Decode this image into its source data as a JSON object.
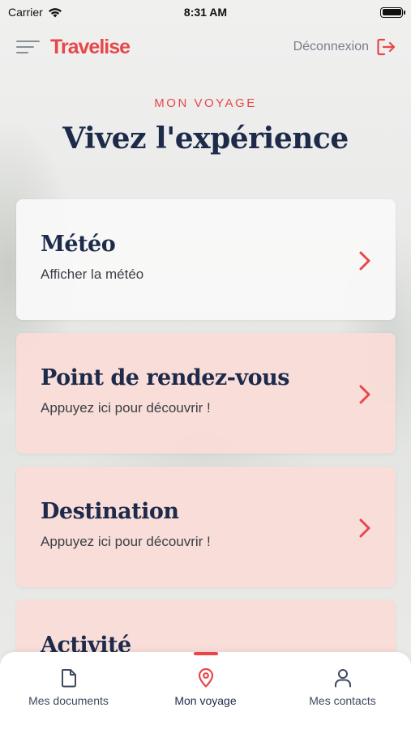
{
  "status_bar": {
    "carrier": "Carrier",
    "time": "8:31 AM"
  },
  "header": {
    "logo": "Travelise",
    "logout_label": "Déconnexion"
  },
  "page": {
    "kicker": "MON VOYAGE",
    "title": "Vivez l'expérience"
  },
  "cards": [
    {
      "title": "Météo",
      "subtitle": "Afficher la météo",
      "style": "white"
    },
    {
      "title": "Point de rendez-vous",
      "subtitle": "Appuyez ici pour découvrir !",
      "style": "pink"
    },
    {
      "title": "Destination",
      "subtitle": "Appuyez ici pour découvrir !",
      "style": "pink"
    },
    {
      "title": "Activité",
      "style": "pink"
    }
  ],
  "tabbar": {
    "tabs": [
      {
        "label": "Mes documents",
        "icon": "document-icon"
      },
      {
        "label": "Mon voyage",
        "icon": "map-pin-icon",
        "active": true
      },
      {
        "label": "Mes contacts",
        "icon": "user-icon"
      }
    ]
  },
  "colors": {
    "accent": "#e8474a",
    "navy": "#1d2a4a",
    "card_pink": "#f9dcd8",
    "card_white": "#f8f8f8"
  }
}
